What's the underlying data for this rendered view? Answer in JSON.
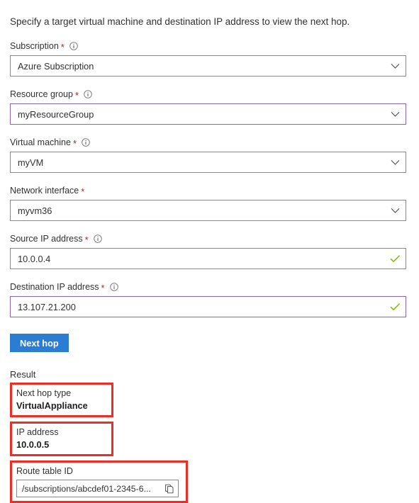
{
  "intro": {
    "text": "Specify a target virtual machine and destination IP address to view the next hop."
  },
  "colors": {
    "accent_blue": "#2b7cd3",
    "focus_purple": "#8764b8",
    "required_red": "#a4262c",
    "highlight_red": "#ee2d24",
    "valid_green": "#7fba00",
    "border_gray": "#8a8886"
  },
  "form": {
    "fields": [
      {
        "label": "Subscription",
        "required": true,
        "has_info": true,
        "value": "Azure Subscription",
        "affix": "chevron-down-icon",
        "focused": false
      },
      {
        "label": "Resource group",
        "required": true,
        "has_info": true,
        "value": "myResourceGroup",
        "affix": "chevron-down-icon",
        "focused": true
      },
      {
        "label": "Virtual machine",
        "required": true,
        "has_info": true,
        "value": "myVM",
        "affix": "chevron-down-icon",
        "focused": false
      },
      {
        "label": "Network interface",
        "required": true,
        "has_info": false,
        "value": "myvm36",
        "affix": "chevron-down-icon",
        "focused": false
      },
      {
        "label": "Source IP address",
        "required": true,
        "has_info": true,
        "value": "10.0.0.4",
        "affix": "checkmark-icon",
        "focused": false
      },
      {
        "label": "Destination IP address",
        "required": true,
        "has_info": true,
        "value": "13.107.21.200",
        "affix": "checkmark-icon",
        "focused": true
      }
    ],
    "submit_label": "Next hop"
  },
  "result": {
    "heading": "Result",
    "next_hop_type": {
      "label": "Next hop type",
      "value": "VirtualAppliance"
    },
    "ip_address": {
      "label": "IP address",
      "value": "10.0.0.5"
    },
    "route_table_id": {
      "label": "Route table ID",
      "value": "/subscriptions/abcdef01-2345-6...",
      "copy_icon": "copy-icon"
    }
  }
}
